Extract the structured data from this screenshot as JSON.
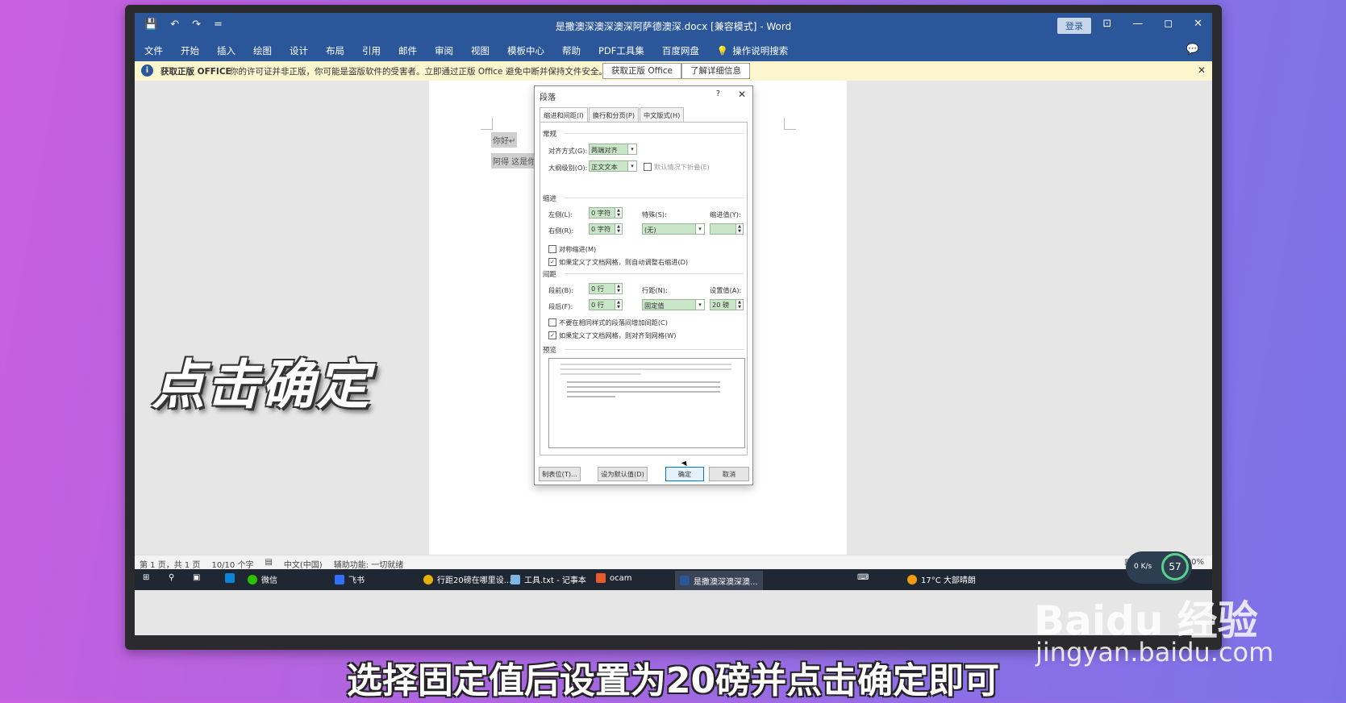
{
  "window": {
    "title": "是撒澳深澳深澳深阿萨德澳深.docx [兼容模式] - Word",
    "login_label": "登录",
    "quick_access": [
      "💾",
      "↶",
      "↷",
      "="
    ],
    "controls": [
      "⊡",
      "—",
      "◻",
      "✕"
    ]
  },
  "ribbon": {
    "tabs": [
      "文件",
      "开始",
      "插入",
      "绘图",
      "设计",
      "布局",
      "引用",
      "邮件",
      "审阅",
      "视图",
      "模板中心",
      "帮助",
      "PDF工具集",
      "百度网盘"
    ],
    "search_label": "操作说明搜索"
  },
  "infobar": {
    "heading": "获取正版 OFFICE",
    "message": "你的许可证并非正版，你可能是盗版软件的受害者。立即通过正版 Office 避免中断并保持文件安全。",
    "btn_get": "获取正版 Office",
    "btn_learn": "了解详细信息"
  },
  "document": {
    "line1": "你好↵",
    "line2": "阿得  这是你"
  },
  "dialog": {
    "title": "段落",
    "help": "?",
    "close": "✕",
    "tabs": [
      "缩进和间距(I)",
      "换行和分页(P)",
      "中文版式(H)"
    ],
    "general": {
      "heading": "常规",
      "align_label": "对齐方式(G):",
      "align_value": "两端对齐",
      "outline_label": "大纲级别(O):",
      "outline_value": "正文文本",
      "collapse_label": "默认情况下折叠(E)"
    },
    "indent": {
      "heading": "缩进",
      "left_label": "左侧(L):",
      "left_value": "0 字符",
      "right_label": "右侧(R):",
      "right_value": "0 字符",
      "special_label": "特殊(S):",
      "special_value": "(无)",
      "indent_val_label": "缩进值(Y):",
      "mirror_label": "对称缩进(M)",
      "auto_adjust_label": "如果定义了文档网格，则自动调整右缩进(D)"
    },
    "spacing": {
      "heading": "间距",
      "before_label": "段前(B):",
      "before_value": "0 行",
      "after_label": "段后(F):",
      "after_value": "0 行",
      "line_label": "行距(N):",
      "line_value": "固定值",
      "at_label": "设置值(A):",
      "at_value": "20 磅",
      "no_space_label": "不要在相同样式的段落间增加间距(C)",
      "snap_label": "如果定义了文档网格，则对齐到网格(W)"
    },
    "preview_heading": "预览",
    "buttons": {
      "tabs": "制表位(T)...",
      "default": "设为默认值(D)",
      "ok": "确定",
      "cancel": "取消"
    }
  },
  "statusbar": {
    "page": "第 1 页，共 1 页",
    "words": "10/10 个字",
    "lang": "中文(中国)",
    "access": "辅助功能: 一切就绪",
    "zoom": "100%"
  },
  "taskbar": {
    "wechat": "微信",
    "feishu": "飞书",
    "chrome": "行距20磅在哪里设...",
    "notepad": "工具.txt - 记事本",
    "ocam": "ocam",
    "word": "是撒澳深澳深澳...",
    "weather": "17°C 大部晴朗"
  },
  "network_widget": {
    "percent": "57",
    "speed": "0 K/s"
  },
  "overlay": {
    "big_caption": "点击确定",
    "subtitle": "选择固定值后设置为20磅并点击确定即可",
    "watermark_logo": "Baidu 经验",
    "watermark_url": "jingyan.baidu.com"
  }
}
